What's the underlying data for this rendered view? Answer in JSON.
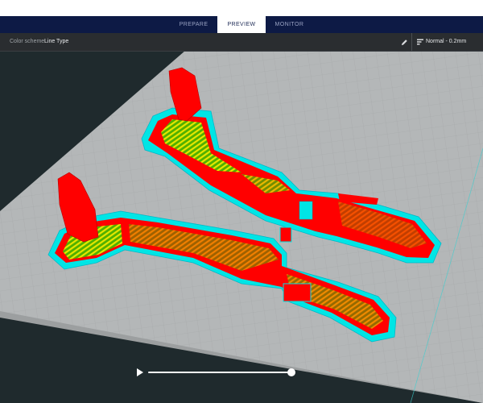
{
  "header": {
    "tabs": [
      {
        "label": "PREPARE",
        "active": false
      },
      {
        "label": "PREVIEW",
        "active": true
      },
      {
        "label": "MONITOR",
        "active": false
      }
    ]
  },
  "settings": {
    "color_scheme_label": "Color scheme",
    "color_scheme_value": "Line Type",
    "edit_icon": "pencil-icon",
    "profile_icon": "sliders-icon",
    "profile_value": "Normal - 0.2mm"
  },
  "viewport": {
    "build_plate_color": "#b4b7b8",
    "background_color": "#1f2a2d",
    "colors": {
      "wall_outer": "#ff0000",
      "infill": "#e6e600",
      "wall_inner": "#00cc00",
      "skirt": "#00e5e5"
    }
  },
  "playback": {
    "play_icon": "play-icon",
    "progress": 1.0
  }
}
